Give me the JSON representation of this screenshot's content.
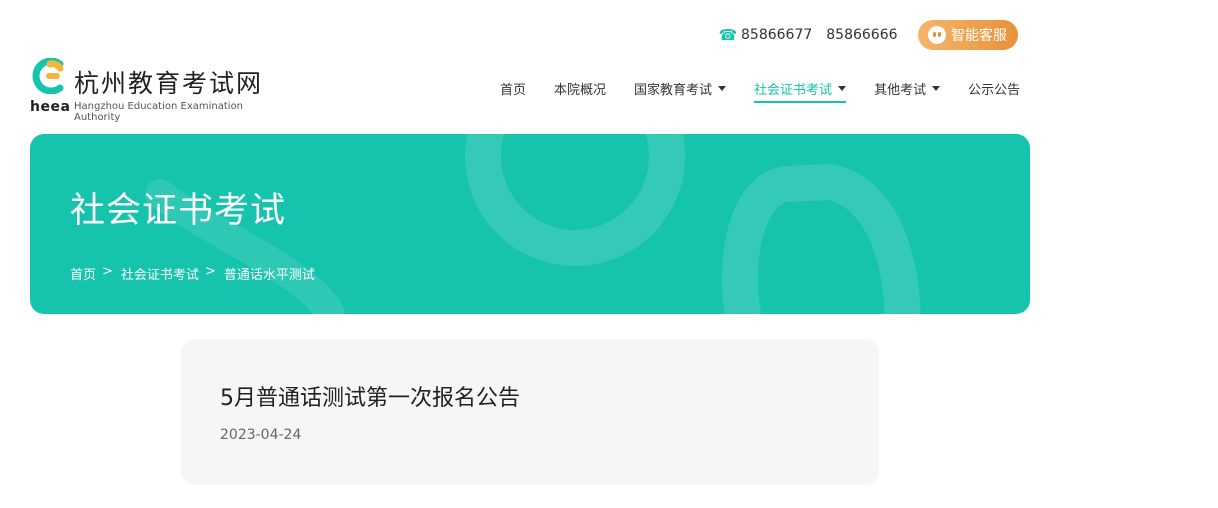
{
  "contact": {
    "phone_icon": "phone-icon",
    "phone_1": "85866677",
    "phone_2": "85866666",
    "service_label": "智能客服",
    "service_icon": "chat-bot-icon"
  },
  "logo": {
    "mark_text": "heea",
    "title": "杭州教育考试网",
    "subtitle_en": "Hangzhou Education Examination Authority"
  },
  "nav": {
    "items": [
      {
        "label": "首页"
      },
      {
        "label": "本院概况"
      },
      {
        "label": "国家教育考试"
      },
      {
        "label": "社会证书考试"
      },
      {
        "label": "其他考试"
      },
      {
        "label": "公示公告"
      }
    ]
  },
  "banner": {
    "title": "社会证书考试",
    "breadcrumb": [
      "首页",
      "社会证书考试",
      "普通话水平测试"
    ],
    "separator": ">"
  },
  "article": {
    "title": "5月普通话测试第一次报名公告",
    "date": "2023-04-24"
  },
  "colors": {
    "accent": "#16c3ad",
    "service_gradient_start": "#f5b66b",
    "service_gradient_end": "#e8913a",
    "card_bg": "#f6f6f6"
  }
}
